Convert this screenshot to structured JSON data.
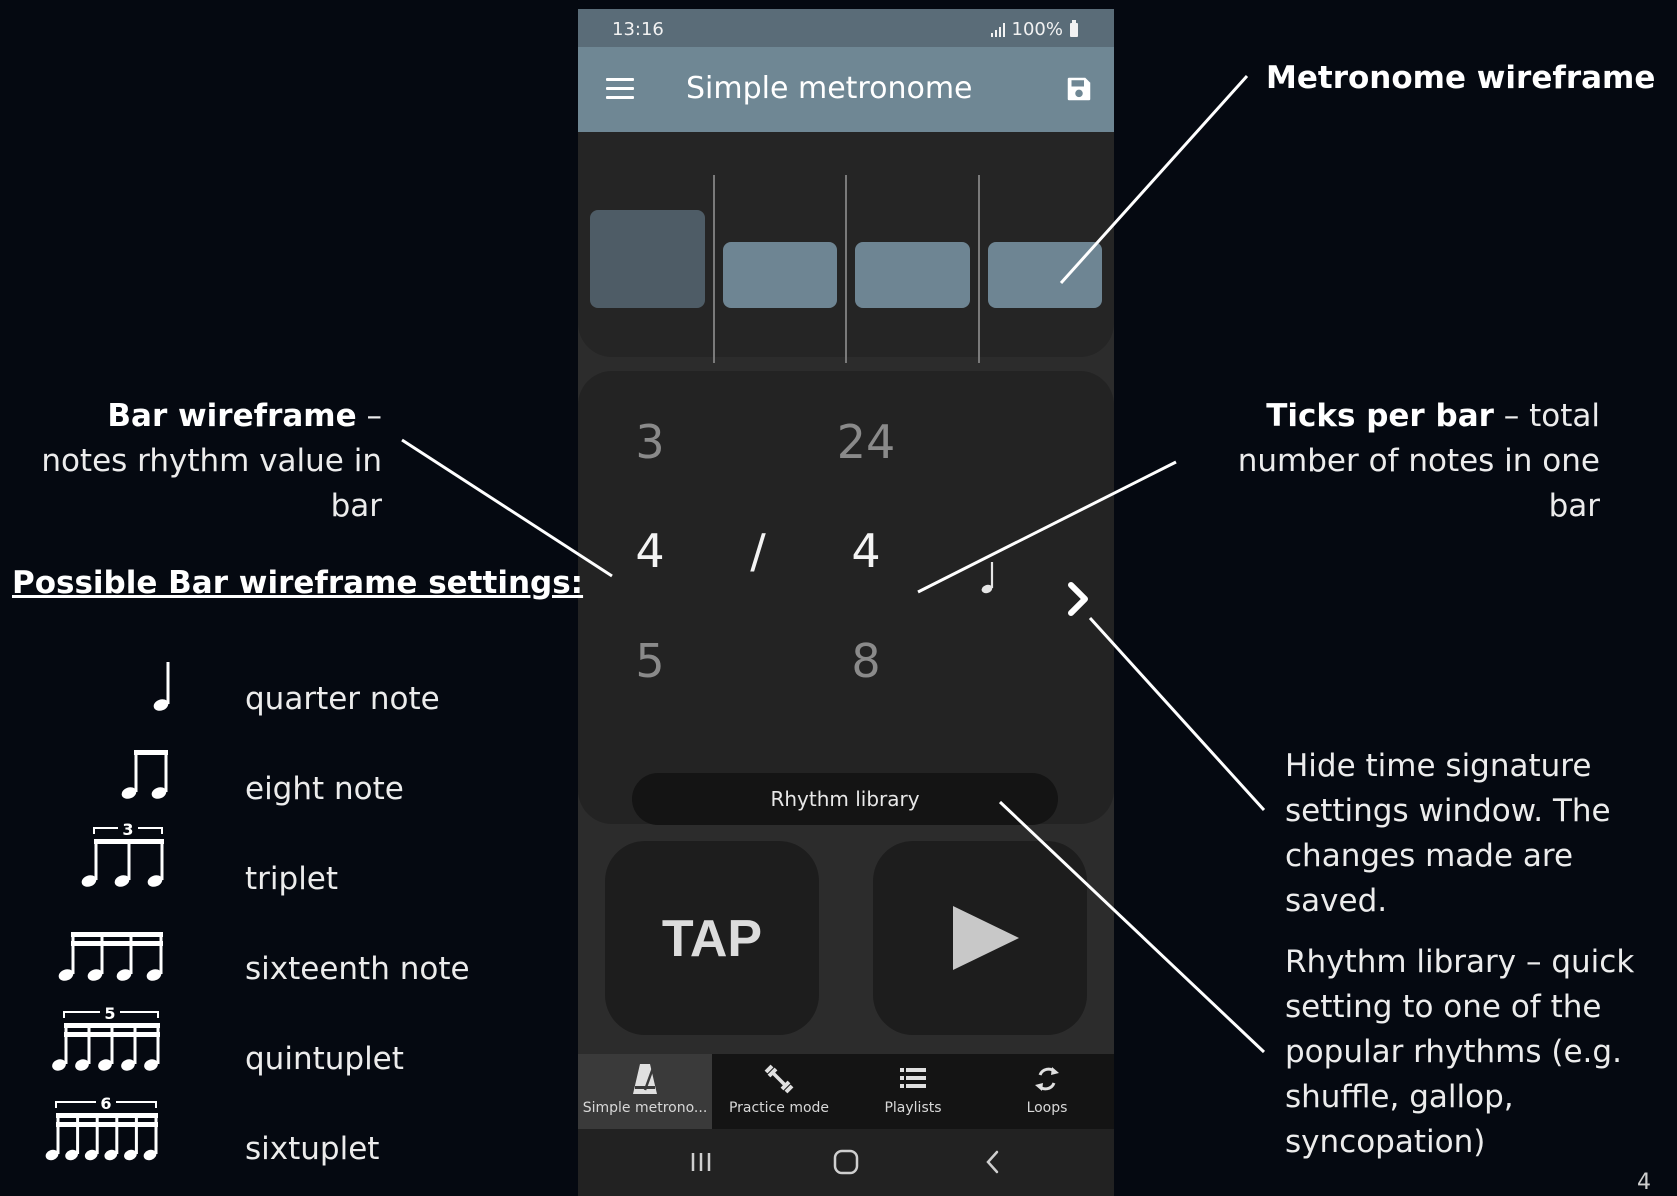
{
  "status_bar": {
    "time": "13:16",
    "battery": "100%"
  },
  "app_bar": {
    "title": "Simple metronome",
    "menu_icon": "hamburger-menu-icon",
    "save_icon": "save-icon"
  },
  "metronome": {
    "beats": 4,
    "accent_beat": 1,
    "colors": {
      "accent": "#4e5c66",
      "beat": "#6e8593",
      "divider": "#7a7a7a"
    }
  },
  "time_signature": {
    "numerator": {
      "previous": "3",
      "current": "4",
      "next": "5"
    },
    "separator": "/",
    "denominator": {
      "previous": "24",
      "current": "4",
      "next": "8"
    },
    "note_value_icon": "quarter-note-icon",
    "collapse_icon": "chevron-right-icon"
  },
  "rhythm_library": {
    "label": "Rhythm library"
  },
  "tap_button": {
    "label": "TAP"
  },
  "play_button": {
    "icon": "play-icon"
  },
  "bottom_nav": [
    {
      "label": "Simple metrono...",
      "icon": "metronome-icon",
      "active": true
    },
    {
      "label": "Practice mode",
      "icon": "dumbbell-icon",
      "active": false
    },
    {
      "label": "Playlists",
      "icon": "list-icon",
      "active": false
    },
    {
      "label": "Loops",
      "icon": "loop-icon",
      "active": false
    }
  ],
  "system_nav": {
    "recents_icon": "recents-icon",
    "home_icon": "home-icon",
    "back_icon": "back-icon"
  },
  "annotations": {
    "metronome_wireframe": "Metronome wireframe",
    "bar_wireframe_title": "Bar wireframe",
    "bar_wireframe_text": " – notes rhythm value in bar",
    "ticks_per_bar_title": "Ticks per bar",
    "ticks_per_bar_text": " – total number of notes in one bar",
    "hide_settings": "Hide time signature settings window. The changes made are saved.",
    "rhythm_library": "Rhythm library – quick setting to one of the popular rhythms (e.g. shuffle, gallop, syncopation)"
  },
  "settings_heading": "Possible Bar wireframe settings:",
  "bar_settings": [
    {
      "label": "quarter note",
      "icon": "quarter-note-icon"
    },
    {
      "label": "eight note",
      "icon": "eighth-notes-icon"
    },
    {
      "label": "triplet",
      "icon": "triplet-icon",
      "tuplet_number": "3"
    },
    {
      "label": "sixteenth note",
      "icon": "sixteenth-notes-icon"
    },
    {
      "label": "quintuplet",
      "icon": "quintuplet-icon",
      "tuplet_number": "5"
    },
    {
      "label": "sixtuplet",
      "icon": "sixtuplet-icon",
      "tuplet_number": "6"
    }
  ],
  "page_number": "4"
}
